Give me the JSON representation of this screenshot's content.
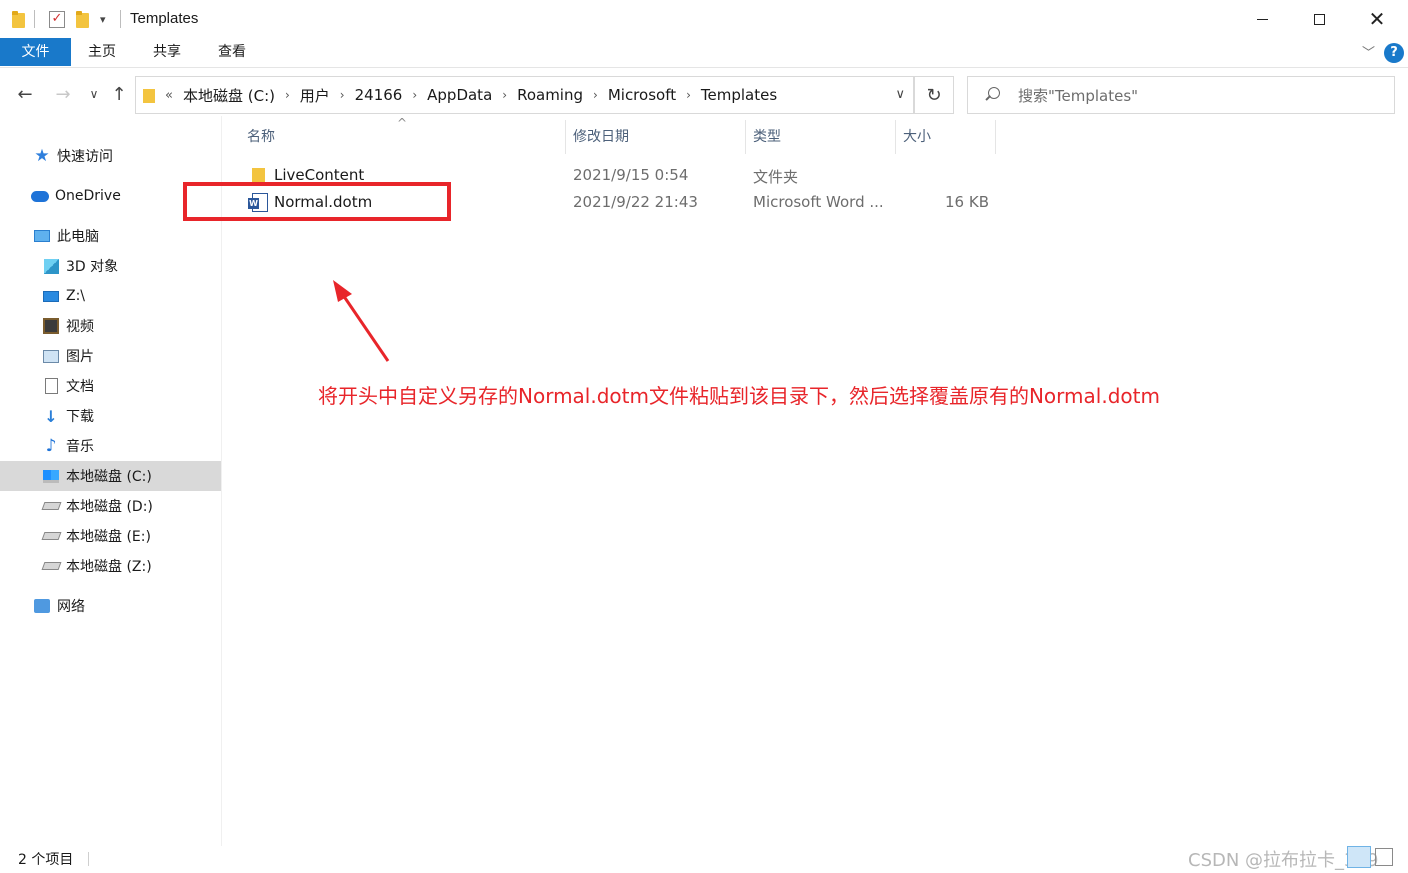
{
  "window": {
    "title": "Templates",
    "quick_access_dropdown": "▾",
    "controls": {
      "minimize": "",
      "maximize": "",
      "close": "✕"
    }
  },
  "ribbon": {
    "tabs": [
      {
        "label": "文件"
      },
      {
        "label": "主页"
      },
      {
        "label": "共享"
      },
      {
        "label": "查看"
      }
    ],
    "collapse_chevron": "﹀",
    "help": "?"
  },
  "navigation": {
    "back": "←",
    "forward": "→",
    "recent": "∨",
    "up": "↑",
    "refresh": "↻",
    "address_dropdown": "∨"
  },
  "address": {
    "overflow": "«",
    "separator": "›",
    "crumbs": [
      "本地磁盘 (C:)",
      "用户",
      "24166",
      "AppData",
      "Roaming",
      "Microsoft",
      "Templates"
    ]
  },
  "search": {
    "placeholder": "搜索\"Templates\""
  },
  "sidebar": {
    "items": [
      {
        "label": "快速访问",
        "icon": "star-icon"
      },
      {
        "label": "OneDrive",
        "icon": "cloud-icon"
      },
      {
        "label": "此电脑",
        "icon": "computer-icon"
      },
      {
        "label": "3D 对象",
        "icon": "cube-icon"
      },
      {
        "label": "Z:\\",
        "icon": "monitor-icon"
      },
      {
        "label": "视频",
        "icon": "film-icon"
      },
      {
        "label": "图片",
        "icon": "picture-icon"
      },
      {
        "label": "文档",
        "icon": "document-icon"
      },
      {
        "label": "下载",
        "icon": "download-icon"
      },
      {
        "label": "音乐",
        "icon": "music-icon"
      },
      {
        "label": "本地磁盘 (C:)",
        "icon": "windows-drive-icon",
        "selected": true
      },
      {
        "label": "本地磁盘 (D:)",
        "icon": "drive-icon"
      },
      {
        "label": "本地磁盘 (E:)",
        "icon": "drive-icon"
      },
      {
        "label": "本地磁盘 (Z:)",
        "icon": "drive-icon"
      },
      {
        "label": "网络",
        "icon": "network-icon"
      }
    ]
  },
  "file_list": {
    "columns": [
      "名称",
      "修改日期",
      "类型",
      "大小"
    ],
    "sort_indicator": "^",
    "rows": [
      {
        "name": "LiveContent",
        "modified": "2021/9/15 0:54",
        "type": "文件夹",
        "size": "",
        "icon": "folder-icon"
      },
      {
        "name": "Normal.dotm",
        "modified": "2021/9/22 21:43",
        "type": "Microsoft Word ...",
        "size": "16 KB",
        "icon": "word-template-icon"
      }
    ]
  },
  "annotation": {
    "text": "将开头中自定义另存的Normal.dotm文件粘贴到该目录下，然后选择覆盖原有的Normal.dotm",
    "color": "#e8252a"
  },
  "status": {
    "item_count": "2 个项目",
    "watermark": "CSDN @拉布拉卡_379"
  },
  "colors": {
    "accent": "#1979ca",
    "selected_bg": "#d9d9d9",
    "highlight": "#e8252a"
  }
}
